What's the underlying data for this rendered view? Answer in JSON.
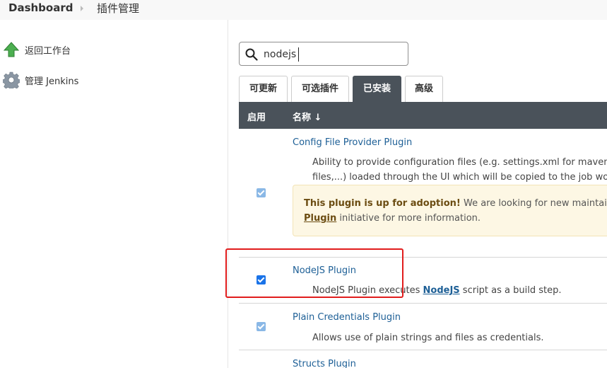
{
  "breadcrumb": {
    "dashboard": "Dashboard",
    "current": "插件管理"
  },
  "sidebar": {
    "items": [
      {
        "label": "返回工作台",
        "icon": "up-arrow-icon"
      },
      {
        "label": "管理 Jenkins",
        "icon": "gear-icon"
      }
    ]
  },
  "search": {
    "value": "nodejs",
    "icon": "search-icon"
  },
  "tabs": [
    {
      "label": "可更新",
      "active": false
    },
    {
      "label": "可选插件",
      "active": false
    },
    {
      "label": "已安装",
      "active": true
    },
    {
      "label": "高级",
      "active": false
    }
  ],
  "table": {
    "headers": {
      "enable": "启用",
      "name": "名称 ↓"
    },
    "rows": [
      {
        "name": "Config File Provider Plugin",
        "desc_line1": "Ability to provide configuration files (e.g. settings.xml for maven, XM",
        "desc_line2": "files,...) loaded through the UI which will be copied to the job worksp",
        "enabled": true,
        "notice": {
          "strong": "This plugin is up for adoption!",
          "text1": " We are looking for new maintainers. ",
          "link": "Plugin",
          "text2": " initiative for more information."
        }
      },
      {
        "name": "NodeJS Plugin",
        "desc_pre": "NodeJS Plugin executes ",
        "desc_link": "NodeJS",
        "desc_post": " script as a build step.",
        "enabled": true
      },
      {
        "name": "Plain Credentials Plugin",
        "desc": "Allows use of plain strings and files as credentials.",
        "enabled": true
      },
      {
        "name": "Structs Plugin"
      }
    ]
  },
  "colors": {
    "header_bg": "#4a525a",
    "link": "#1d5f96",
    "checkbox_on": "#1a73e8",
    "checkbox_disabled": "#8ab8e6",
    "highlight": "#e11d1d",
    "notice_bg": "#fdf7e4"
  }
}
